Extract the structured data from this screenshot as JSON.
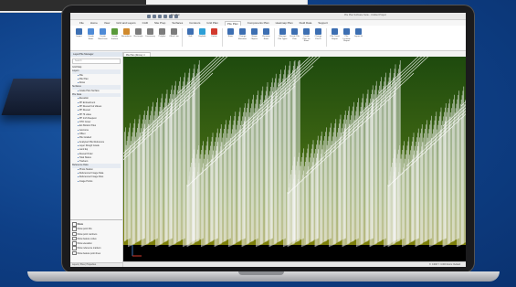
{
  "colors": {
    "background": "#0e3f86",
    "terrain_top": "#1e4a0e",
    "terrain_mid": "#5b7a12",
    "terrain_low": "#7d7f0a",
    "pile_rows": "#f5f5f5",
    "accent": "#3d6fb2"
  },
  "titlebar": {
    "tab_left": "Site Plan",
    "title": "Pile Plan Software Suite - Untitled Project",
    "quick_access_icons": [
      "save-icon",
      "undo-icon",
      "redo-icon",
      "open-icon",
      "print-icon",
      "settings-icon"
    ]
  },
  "tabs": [
    "File",
    "Home",
    "View",
    "Grid and Layers",
    "CAD",
    "Site Prep",
    "Surfaces",
    "Contours",
    "Grid Plan",
    "Pile Plan",
    "Components Plan",
    "Heatmap Plan",
    "Field Data",
    "Support"
  ],
  "active_tab_index": 9,
  "ribbon": {
    "buttons": [
      {
        "label": "Import",
        "icon": "import-icon",
        "color": "#3d6fb2"
      },
      {
        "label": "Create Rows",
        "icon": "rows-icon",
        "color": "#4f8bd6"
      },
      {
        "label": "Create Row From",
        "icon": "row-from-icon",
        "color": "#4f8bd6"
      },
      {
        "label": "Create Surface",
        "icon": "surface-icon",
        "color": "#5a9a3b"
      },
      {
        "label": "Boundaries",
        "icon": "boundary-icon",
        "color": "#d08a2e"
      },
      {
        "label": "Rectangle",
        "icon": "rectangle-icon",
        "color": "#7c7c7c"
      },
      {
        "label": "Lineaarray",
        "icon": "array-icon",
        "color": "#7c7c7c"
      },
      {
        "label": "Polyline",
        "icon": "polyline-icon",
        "color": "#7c7c7c"
      },
      {
        "label": "Offset Line",
        "icon": "offset-icon",
        "color": "#7c7c7c"
      },
      {
        "label": "Edit",
        "icon": "edit-icon",
        "color": "#3d6fb2"
      },
      {
        "label": "Explode",
        "icon": "explode-icon",
        "color": "#2e9fd6"
      },
      {
        "label": "Delete",
        "icon": "delete-icon",
        "color": "#d23a2e"
      },
      {
        "label": "Rows",
        "icon": "rows-list-icon",
        "color": "#3d6fb2"
      },
      {
        "label": "Change Elevation",
        "icon": "elevation-icon",
        "color": "#3d6fb2"
      },
      {
        "label": "Shape Objects",
        "icon": "shape-icon",
        "color": "#3d6fb2"
      },
      {
        "label": "Rename Rows",
        "icon": "rename-icon",
        "color": "#3d6fb2"
      },
      {
        "label": "Manage Pile Types",
        "icon": "manage-icon",
        "color": "#3d6fb2"
      },
      {
        "label": "Create Pile Plan",
        "icon": "pile-plan-icon",
        "color": "#3d6fb2"
      },
      {
        "label": "Create Piles on Rows",
        "icon": "piles-rows-icon",
        "color": "#3d6fb2"
      },
      {
        "label": "Change Pile ID",
        "icon": "pile-id-icon",
        "color": "#3d6fb2"
      },
      {
        "label": "Pile Count Report",
        "icon": "report-icon",
        "color": "#3d6fb2"
      },
      {
        "label": "Pile Location Report",
        "icon": "location-icon",
        "color": "#3d6fb2"
      },
      {
        "label": "Import Id",
        "icon": "import-id-icon",
        "color": "#3d6fb2"
      }
    ]
  },
  "panel": {
    "header": "Layer/Pile Manager",
    "search_placeholder": "Search",
    "tree": [
      {
        "label": "Grid Map",
        "section": false
      },
      {
        "label": "Layers",
        "section": true
      },
      {
        "label": "Pile",
        "section": false,
        "indent": true
      },
      {
        "label": "Pile Plan",
        "section": false,
        "indent": true
      },
      {
        "label": "Rows",
        "section": false,
        "indent": true
      },
      {
        "label": "Surfaces",
        "section": true
      },
      {
        "label": "Grade Plan Surface",
        "section": false,
        "indent": true
      },
      {
        "label": "Pile Data",
        "section": true
      },
      {
        "label": "Elevation",
        "section": false,
        "indent": true
      },
      {
        "label": "PP Embedment",
        "section": false,
        "indent": true
      },
      {
        "label": "PP Reveal Cut Values",
        "section": false,
        "indent": true
      },
      {
        "label": "PP Reveal",
        "section": false,
        "indent": true
      },
      {
        "label": "PP Ht value",
        "section": false,
        "indent": true
      },
      {
        "label": "PP Inch Deepest",
        "section": false,
        "indent": true
      },
      {
        "label": "NTO Cover",
        "section": false,
        "indent": true
      },
      {
        "label": "Ext Bottom Piles",
        "section": false,
        "indent": true
      },
      {
        "label": "Isocrome",
        "section": false,
        "indent": true
      },
      {
        "label": "Offset",
        "section": false,
        "indent": true
      },
      {
        "label": "Pile Graded",
        "section": false,
        "indent": true
      },
      {
        "label": "Analyzed Pile Reference",
        "section": false,
        "indent": true
      },
      {
        "label": "Layer Rough Grade",
        "section": false,
        "indent": true
      },
      {
        "label": "Land Eq",
        "section": false,
        "indent": true
      },
      {
        "label": "Reveal Order",
        "section": false,
        "indent": true
      },
      {
        "label": "Total Status",
        "section": false,
        "indent": true
      },
      {
        "label": "Trackers",
        "section": false,
        "indent": true
      },
      {
        "label": "Reference Data",
        "section": true
      },
      {
        "label": "Photo Station",
        "section": false,
        "indent": true
      },
      {
        "label": "Referenced Image Data",
        "section": false,
        "indent": true
      },
      {
        "label": "Referenced Image Files",
        "section": false,
        "indent": true
      },
      {
        "label": "Image Points",
        "section": false,
        "indent": true
      }
    ],
    "options_header": "Show",
    "options": [
      "Show point IDs",
      "Show point numbers",
      "Show feature codes",
      "Show elevation",
      "Show reference markers",
      "Show feature point lines"
    ],
    "footer_tabs": "Layers | Piles | Properties"
  },
  "doc_tab": "Pile Plan (Drone) ✕",
  "statusbar": "X: 0.000  Y: 0.000  Zoom: Default",
  "chart_data": {
    "type": "scatter",
    "rows": 24,
    "piles_per_row": 9
  }
}
